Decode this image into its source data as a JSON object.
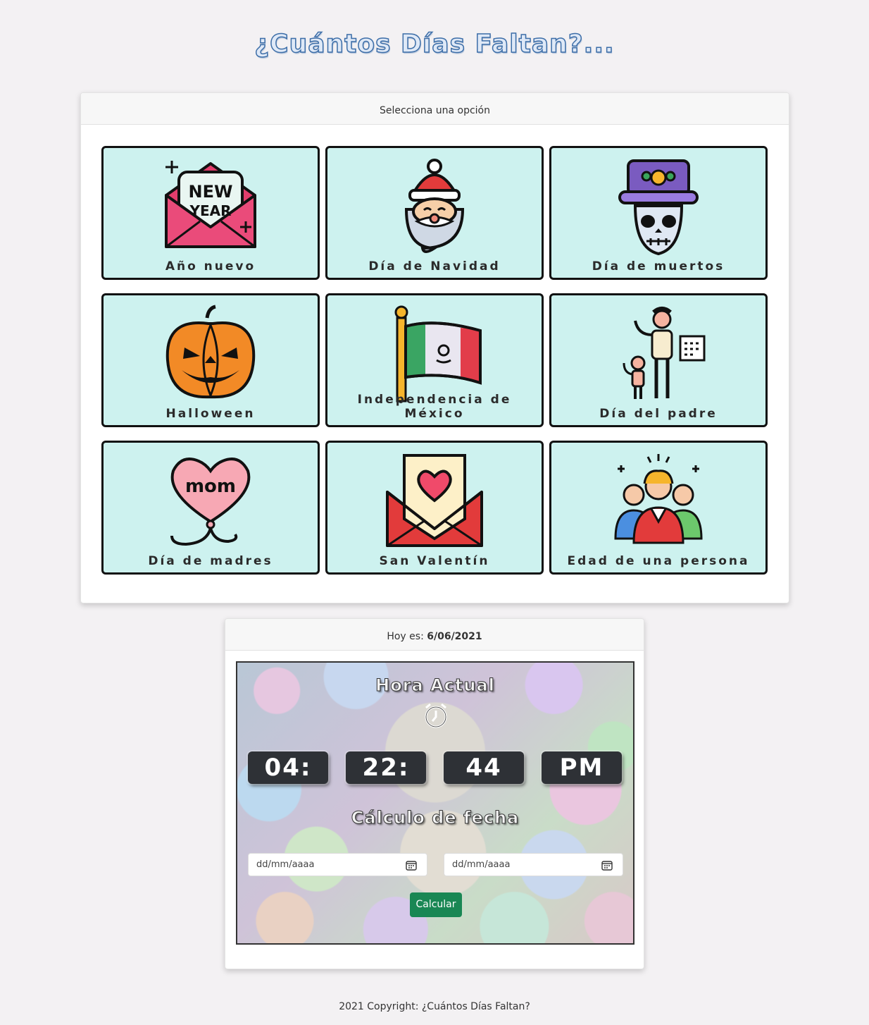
{
  "title": "¿Cuántos Días Faltan?...",
  "options_card": {
    "header": "Selecciona una opción",
    "tiles": [
      {
        "label": "Año nuevo",
        "icon": "new-year-envelope-icon"
      },
      {
        "label": "Día de Navidad",
        "icon": "santa-claus-icon"
      },
      {
        "label": "Día de muertos",
        "icon": "catrina-skull-icon"
      },
      {
        "label": "Halloween",
        "icon": "jack-o-lantern-icon"
      },
      {
        "label": "Independencia de México",
        "icon": "mexico-flag-icon"
      },
      {
        "label": "Día del padre",
        "icon": "father-child-icon"
      },
      {
        "label": "Día de madres",
        "icon": "mom-balloon-icon"
      },
      {
        "label": "San Valentín",
        "icon": "heart-envelope-icon"
      },
      {
        "label": "Edad de una persona",
        "icon": "people-group-icon"
      }
    ],
    "new_year_text": [
      "NEW",
      "YEAR"
    ],
    "mom_text": "mom"
  },
  "clock_card": {
    "today_label": "Hoy es:",
    "today_value": "6/06/2021",
    "hora_title": "Hora Actual",
    "hours": "04:",
    "minutes": "22:",
    "seconds": "44",
    "ampm": "PM",
    "calculo_title": "Cálculo de fecha",
    "date_placeholder_1": "dd/mm/aaaa",
    "date_placeholder_2": "dd/mm/aaaa",
    "calc_button": "Calcular"
  },
  "footer": "2021 Copyright: ¿Cuántos Días Faltan?",
  "colors": {
    "title": "#3d6ea8",
    "tile_bg": "#cdf2ef",
    "button": "#198754"
  }
}
